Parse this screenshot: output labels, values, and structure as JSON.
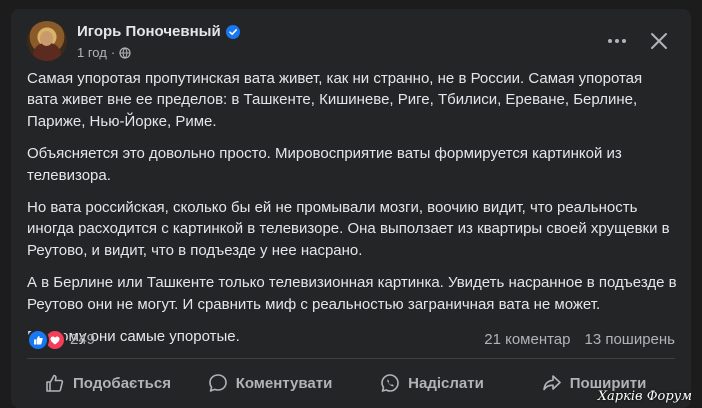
{
  "post": {
    "author": "Игорь Поночевный",
    "time": "1 год",
    "separator": "·",
    "paragraphs": [
      "Самая упоротая пропутинская вата живет, как ни странно, не в России. Самая упоротая вата живет вне ее пределов: в Ташкенте, Кишиневе, Риге, Тбилиси, Ереване, Берлине, Париже, Нью-Йорке, Риме.",
      "Объясняется это довольно просто. Мировосприятие ваты формируется картинкой из телевизора.",
      "Но вата российская, сколько бы ей не промывали мозги, воочию видит, что реальность иногда расходится с картинкой в телевизоре. Она выползает из квартиры своей хрущевки в Реутово, и видит, что в подъезде у нее насрано.",
      "А в Берлине или Ташкенте только телевизионная картинка. Увидеть насранное в подъезде в Реутово они не могут. И сравнить миф с реальностью заграничная вата не может.",
      "Поэтому они самые упоротые."
    ],
    "reaction_count": "249",
    "comments": "21 коментар",
    "shares": "13 поширень"
  },
  "actions": {
    "like": "Подобається",
    "comment": "Коментувати",
    "send": "Надіслати",
    "share": "Поширити"
  },
  "watermark": "Харків Форум",
  "colors": {
    "background": "#1c1c1d",
    "card": "#242526",
    "text": "#e4e6eb",
    "secondary": "#b0b3b8",
    "like_blue": "#1877f2",
    "love_red": "#f33e58"
  }
}
